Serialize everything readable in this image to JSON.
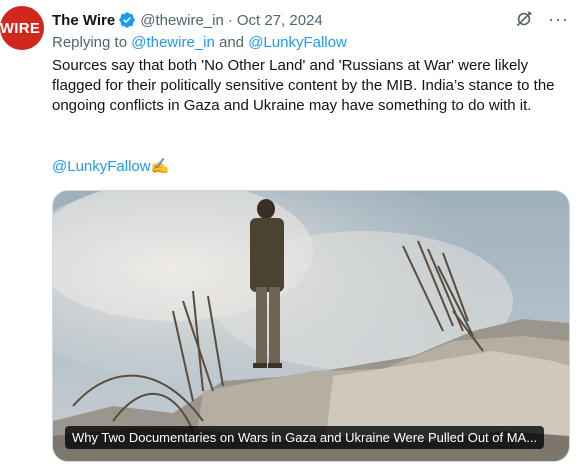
{
  "author": {
    "avatar_text": "WIRE",
    "name": "The Wire",
    "handle": "@thewire_in",
    "separator": "·",
    "date": "Oct 27, 2024"
  },
  "icons": {
    "grok": "grok-icon",
    "more": "more-icon",
    "verified": "verified-badge-icon"
  },
  "reply": {
    "prefix": "Replying to ",
    "mention1": "@thewire_in",
    "joiner": " and ",
    "mention2": "@LunkyFallow"
  },
  "tweet": {
    "body": "Sources say that both 'No Other Land' and 'Russians at War' were likely flagged for their politically sensitive content by the MIB. India’s stance to the ongoing conflicts in Gaza and Ukraine may have something to do with it.",
    "mention": "@LunkyFallow",
    "emoji": "✍️"
  },
  "media": {
    "caption": "Why Two Documentaries on Wars in Gaza and Ukraine Were Pulled Out of MA..."
  },
  "colors": {
    "accent": "#1d9bf0",
    "brand": "#d0281c",
    "secondary_text": "#536471"
  }
}
